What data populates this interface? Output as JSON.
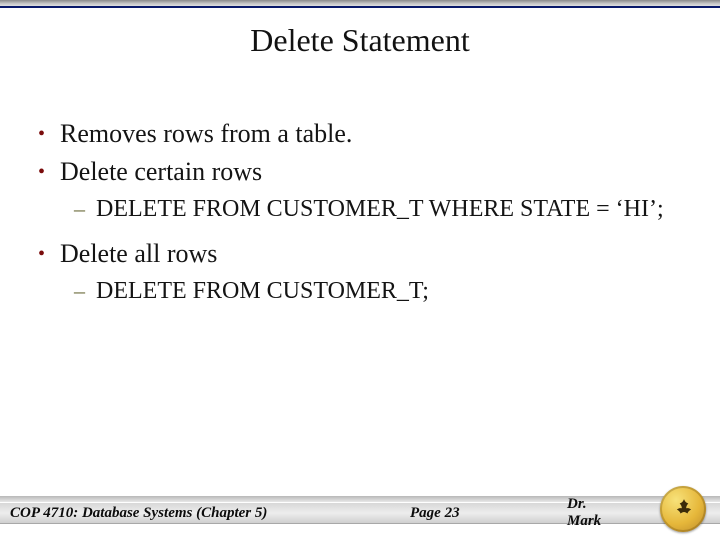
{
  "slide": {
    "title": "Delete Statement",
    "bullets": [
      {
        "text": "Removes rows from a table.",
        "subs": []
      },
      {
        "text": "Delete certain rows",
        "subs": [
          "DELETE FROM CUSTOMER_T WHERE STATE = ‘HI’;"
        ]
      },
      {
        "text": "Delete all rows",
        "subs": [
          "DELETE FROM CUSTOMER_T;"
        ]
      }
    ]
  },
  "footer": {
    "course": "COP 4710: Database Systems  (Chapter 5)",
    "page": "Page 23",
    "author": "Dr. Mark"
  },
  "glyphs": {
    "bullet": "•",
    "dash": "–"
  }
}
